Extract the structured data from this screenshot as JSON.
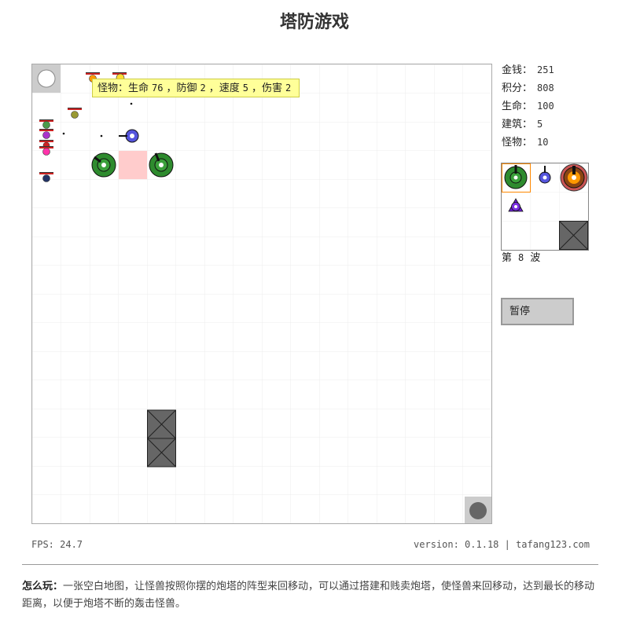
{
  "page": {
    "title": "塔防游戏"
  },
  "tooltip": {
    "monster_label": "怪物：",
    "hp_label": "生命",
    "hp_value": "76",
    "sep1": "，",
    "def_label": "防御",
    "def_value": "2",
    "sep2": "，",
    "spd_label": "速度",
    "spd_value": "5",
    "sep3": "，",
    "dmg_label": "伤害",
    "dmg_value": "2"
  },
  "stats": [
    {
      "label": "金钱：",
      "value": "251"
    },
    {
      "label": "积分：",
      "value": "808"
    },
    {
      "label": "生命：",
      "value": "100"
    },
    {
      "label": "建筑：",
      "value": "5"
    },
    {
      "label": "怪物：",
      "value": "10"
    }
  ],
  "wave": {
    "prefix": "第",
    "number": "8",
    "suffix": "波"
  },
  "controls": {
    "pause_label": "暂停"
  },
  "footer": {
    "fps": "FPS: 24.7",
    "version": "version: 0.1.18 | ",
    "site": "tafang123.com"
  },
  "howto": {
    "label": "怎么玩：",
    "text": "一张空白地图，让怪兽按照你摆的炮塔的阵型来回移动，可以通过搭建和贱卖炮塔，使怪兽来回移动，达到最长的移动距离，以便于炮塔不断的轰击怪兽。"
  },
  "colors": {
    "green_tower": "#2e8b2e",
    "blue_tower": "#4444cc",
    "brown_tower": "#8b4513",
    "purple_tower": "#6a1fd1",
    "wall": "#666666",
    "highlight": "#ffcccc",
    "palette_select": "#ff8800"
  },
  "icons": {
    "entrance": "white-circle-icon",
    "exit": "gray-circle-icon",
    "wall": "crossed-box-icon"
  }
}
